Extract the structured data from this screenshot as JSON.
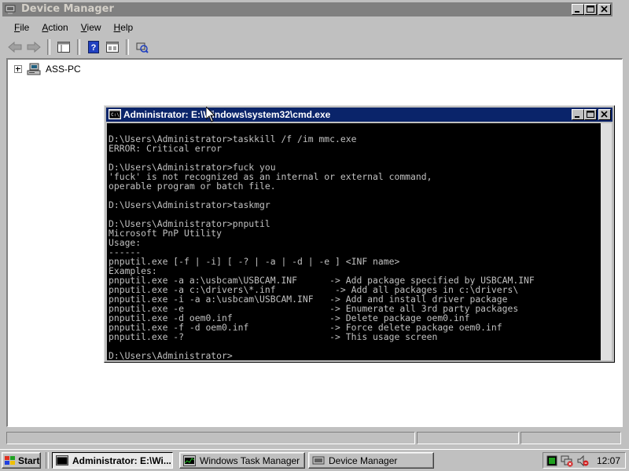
{
  "device_manager": {
    "title": "Device Manager",
    "menu": [
      "File",
      "Action",
      "View",
      "Help"
    ],
    "menu_underline": [
      "F",
      "A",
      "V",
      "H"
    ],
    "tree_root": "ASS-PC",
    "toolbar_icons": [
      "back-arrow-icon",
      "forward-arrow-icon",
      "show-hide-console-tree-icon",
      "help-icon",
      "properties-icon",
      "scan-hardware-icon"
    ]
  },
  "cmd": {
    "title": "Administrator: E:\\Windows\\system32\\cmd.exe",
    "lines": [
      "",
      "D:\\Users\\Administrator>taskkill /f /im mmc.exe",
      "ERROR: Critical error",
      "",
      "D:\\Users\\Administrator>fuck you",
      "'fuck' is not recognized as an internal or external command,",
      "operable program or batch file.",
      "",
      "D:\\Users\\Administrator>taskmgr",
      "",
      "D:\\Users\\Administrator>pnputil",
      "Microsoft PnP Utility",
      "Usage:",
      "------",
      "pnputil.exe [-f | -i] [ -? | -a | -d | -e ] <INF name>",
      "Examples:",
      "pnputil.exe -a a:\\usbcam\\USBCAM.INF      -> Add package specified by USBCAM.INF",
      "pnputil.exe -a c:\\drivers\\*.inf           -> Add all packages in c:\\drivers\\",
      "pnputil.exe -i -a a:\\usbcam\\USBCAM.INF   -> Add and install driver package",
      "pnputil.exe -e                           -> Enumerate all 3rd party packages",
      "pnputil.exe -d oem0.inf                  -> Delete package oem0.inf",
      "pnputil.exe -f -d oem0.inf               -> Force delete package oem0.inf",
      "pnputil.exe -?                           -> This usage screen",
      "",
      "D:\\Users\\Administrator>"
    ]
  },
  "taskbar": {
    "start_label": "Start",
    "tasks": [
      {
        "label": "Administrator: E:\\Wi...",
        "active": true
      },
      {
        "label": "Windows Task Manager",
        "active": false
      },
      {
        "label": "Device Manager",
        "active": false
      }
    ],
    "clock": "12:07",
    "tray_icons": [
      "task-manager-cpu-icon",
      "network-disconnected-icon",
      "volume-muted-icon"
    ]
  },
  "colors": {
    "inactive_title": "#808080",
    "active_title": "#0a246a",
    "console_bg": "#000000",
    "console_fg": "#c0c0c0",
    "face": "#c0c0c0"
  }
}
